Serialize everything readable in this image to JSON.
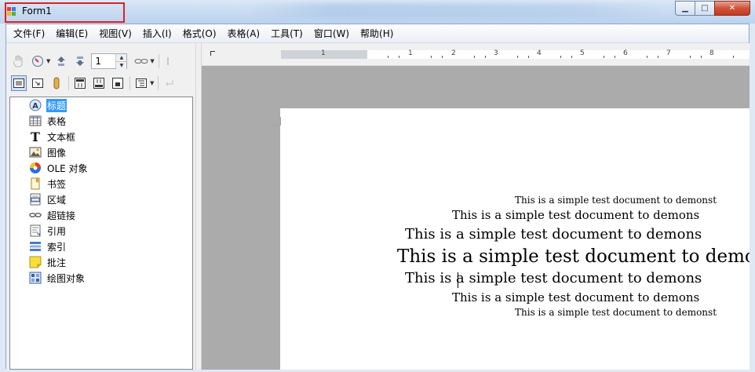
{
  "window": {
    "title": "Form1",
    "controls": {
      "minimize": "▁",
      "maximize": "□",
      "close": "✕"
    }
  },
  "menu": [
    "文件(F)",
    "编辑(E)",
    "视图(V)",
    "插入(I)",
    "格式(O)",
    "表格(A)",
    "工具(T)",
    "窗口(W)",
    "帮助(H)"
  ],
  "toolbar": {
    "spin_value": "1"
  },
  "navigator": {
    "items": [
      {
        "label": "标题",
        "icon": "heading-icon",
        "selected": true
      },
      {
        "label": "表格",
        "icon": "table-icon"
      },
      {
        "label": "文本框",
        "icon": "text-frame-icon"
      },
      {
        "label": "图像",
        "icon": "image-icon"
      },
      {
        "label": "OLE 对象",
        "icon": "ole-object-icon"
      },
      {
        "label": "书签",
        "icon": "bookmark-icon"
      },
      {
        "label": "区域",
        "icon": "section-icon"
      },
      {
        "label": "超链接",
        "icon": "hyperlink-icon"
      },
      {
        "label": "引用",
        "icon": "reference-icon"
      },
      {
        "label": "索引",
        "icon": "index-icon"
      },
      {
        "label": "批注",
        "icon": "comment-icon"
      },
      {
        "label": "绘图对象",
        "icon": "drawing-object-icon"
      }
    ]
  },
  "ruler": {
    "numbers": [
      "1",
      "1",
      "1",
      "2",
      "3",
      "4",
      "5",
      "6",
      "7",
      "8"
    ]
  },
  "document": {
    "lines": [
      "This is a simple test document to demonst",
      "This is a simple test document to demons",
      "This is a simple test document to demons",
      "This is a simple test document to demons",
      "This is a simple test document to demons",
      "This is a simple test document to demons",
      "This is a simple test document to demonst"
    ]
  },
  "colors": {
    "selection": "#3399ff",
    "title_highlight": "#e02020"
  }
}
